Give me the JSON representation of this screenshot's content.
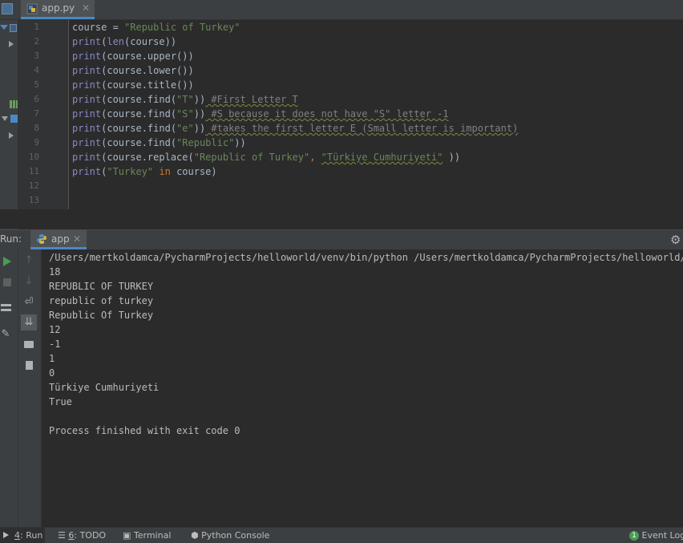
{
  "editor": {
    "tab": {
      "label": "app.py"
    },
    "line_numbers": [
      "1",
      "2",
      "3",
      "4",
      "5",
      "6",
      "7",
      "8",
      "9",
      "10",
      "11",
      "12",
      "13"
    ],
    "lines": [
      [
        {
          "t": "course = ",
          "c": ""
        },
        {
          "t": "\"Republic of Turkey\"",
          "c": "str"
        }
      ],
      [
        {
          "t": "print",
          "c": "fn"
        },
        {
          "t": "(",
          "c": ""
        },
        {
          "t": "len",
          "c": "fn"
        },
        {
          "t": "(course))",
          "c": ""
        }
      ],
      [
        {
          "t": "print",
          "c": "fn"
        },
        {
          "t": "(course.upper())",
          "c": ""
        }
      ],
      [
        {
          "t": "print",
          "c": "fn"
        },
        {
          "t": "(course.lower())",
          "c": ""
        }
      ],
      [
        {
          "t": "print",
          "c": "fn"
        },
        {
          "t": "(course.title())",
          "c": ""
        }
      ],
      [
        {
          "t": "print",
          "c": "fn"
        },
        {
          "t": "(course.find(",
          "c": ""
        },
        {
          "t": "\"T\"",
          "c": "str"
        },
        {
          "t": "))",
          "c": ""
        },
        {
          "t": " #First Letter T",
          "c": "cm wavy"
        }
      ],
      [
        {
          "t": "print",
          "c": "fn"
        },
        {
          "t": "(course.find(",
          "c": ""
        },
        {
          "t": "\"S\"",
          "c": "str"
        },
        {
          "t": "))",
          "c": ""
        },
        {
          "t": " #S because it does not have \"S\" letter -1",
          "c": "cm wavy"
        }
      ],
      [
        {
          "t": "print",
          "c": "fn"
        },
        {
          "t": "(course.find(",
          "c": ""
        },
        {
          "t": "\"e\"",
          "c": "str"
        },
        {
          "t": "))",
          "c": ""
        },
        {
          "t": " #takes the first letter E (Small letter is important)",
          "c": "cm wavy"
        }
      ],
      [
        {
          "t": "print",
          "c": "fn"
        },
        {
          "t": "(course.find(",
          "c": ""
        },
        {
          "t": "\"Republic\"",
          "c": "str"
        },
        {
          "t": "))",
          "c": ""
        }
      ],
      [
        {
          "t": "print",
          "c": "fn"
        },
        {
          "t": "(course.replace(",
          "c": ""
        },
        {
          "t": "\"Republic of Turkey\"",
          "c": "str"
        },
        {
          "t": ", ",
          "c": "kw"
        },
        {
          "t": "\"Türkiye Cumhuriyeti\"",
          "c": "str wavy"
        },
        {
          "t": " ))",
          "c": ""
        }
      ],
      [
        {
          "t": "print",
          "c": "fn"
        },
        {
          "t": "(",
          "c": ""
        },
        {
          "t": "\"Turkey\"",
          "c": "str"
        },
        {
          "t": " in ",
          "c": "kw"
        },
        {
          "t": "course)",
          "c": ""
        }
      ],
      [],
      []
    ]
  },
  "run": {
    "label": "Run:",
    "tab_label": "app",
    "output": [
      "/Users/mertkoldamca/PycharmProjects/helloworld/venv/bin/python /Users/mertkoldamca/PycharmProjects/helloworld/app",
      "18",
      "REPUBLIC OF TURKEY",
      "republic of turkey",
      "Republic Of Turkey",
      "12",
      "-1",
      "1",
      "0",
      "Türkiye Cumhuriyeti",
      "True",
      "",
      "Process finished with exit code 0"
    ]
  },
  "statusbar": {
    "run": {
      "num": "4",
      "label": "Run"
    },
    "todo": {
      "num": "6",
      "label": "TODO"
    },
    "terminal": "Terminal",
    "python_console": "Python Console",
    "event_log": {
      "count": "1",
      "label": "Event Log"
    }
  },
  "colors": {
    "background": "#2b2b2b",
    "keyword": "#cc7832",
    "builtin": "#8888c6",
    "string": "#6a8759",
    "comment": "#808080",
    "run_green": "#499c54",
    "tab_underline": "#4a88c7"
  },
  "icons": [
    "python-file-icon",
    "close-icon",
    "gear-icon",
    "run-icon",
    "stop-icon",
    "arrow-up-icon",
    "arrow-down-icon",
    "soft-wrap-icon",
    "scroll-to-end-icon",
    "print-icon",
    "trash-icon",
    "layout-icon",
    "pin-icon"
  ]
}
